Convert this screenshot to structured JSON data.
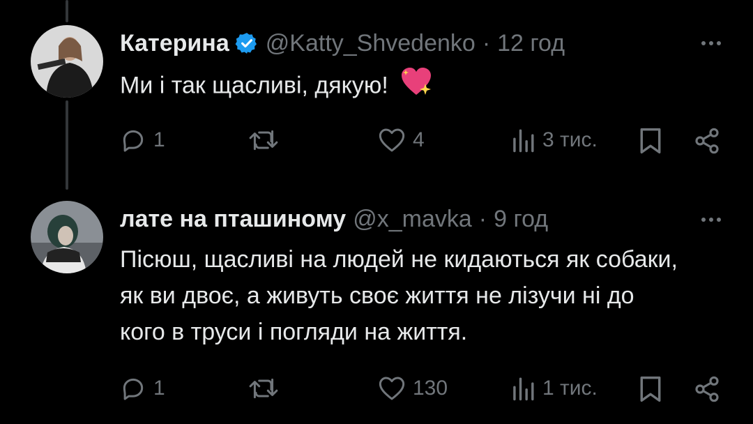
{
  "tweets": [
    {
      "name": "Катерина",
      "handle": "@Katty_Shvedenko",
      "separator": "·",
      "time": "12 год",
      "text": "Ми і так щасливі, дякую!",
      "emoji": "💖",
      "verified": true,
      "replies": "1",
      "retweets": "",
      "likes": "4",
      "views": "3 тис."
    },
    {
      "name": "лате на пташиному",
      "handle": "@x_mavka",
      "separator": "·",
      "time": "9 год",
      "text": "Пісюш, щасливі на людей не кидаються як собаки, як ви двоє, а живуть своє життя не лізучи ні до кого в труси і погляди на життя.",
      "verified": false,
      "replies": "1",
      "retweets": "",
      "likes": "130",
      "views": "1 тис."
    }
  ],
  "colors": {
    "background": "#000000",
    "text": "#e7e9ea",
    "muted": "#71767b",
    "verified": "#1d9bf0",
    "thread_line": "#333639"
  },
  "icons": [
    "reply-icon",
    "retweet-icon",
    "like-icon",
    "views-icon",
    "bookmark-icon",
    "share-icon",
    "verified-badge-icon",
    "more-icon"
  ]
}
